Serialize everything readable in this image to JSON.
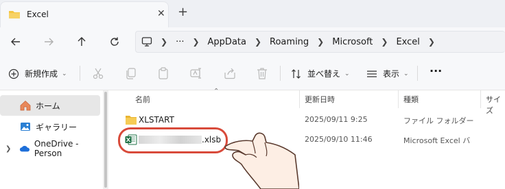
{
  "tab": {
    "title": "Excel",
    "close": "✕",
    "new_tab": "+"
  },
  "breadcrumb": {
    "more": "···",
    "items": [
      "AppData",
      "Roaming",
      "Microsoft",
      "Excel"
    ]
  },
  "toolbar": {
    "new_label": "新規作成",
    "sort_label": "並べ替え",
    "view_label": "表示",
    "more": "···"
  },
  "sidebar": {
    "items": [
      {
        "label": "ホーム",
        "icon": "home-icon",
        "selected": true
      },
      {
        "label": "ギャラリー",
        "icon": "gallery-icon",
        "selected": false
      },
      {
        "label": "OneDrive - Person",
        "icon": "onedrive-icon",
        "selected": false
      }
    ]
  },
  "columns": {
    "name": "名前",
    "date": "更新日時",
    "type": "種類",
    "size": "サイズ"
  },
  "files": [
    {
      "name": "XLSTART",
      "date": "2025/09/11 9:25",
      "type": "ファイル フォルダー",
      "icon": "folder-icon"
    },
    {
      "name": ".xlsb",
      "date": "2025/09/10 11:46",
      "type": "Microsoft Excel バ",
      "icon": "excel-icon"
    }
  ],
  "colors": {
    "accent": "#0067c0",
    "folder": "#f4c542",
    "excel": "#1e7145",
    "highlight": "#d84a3a"
  }
}
